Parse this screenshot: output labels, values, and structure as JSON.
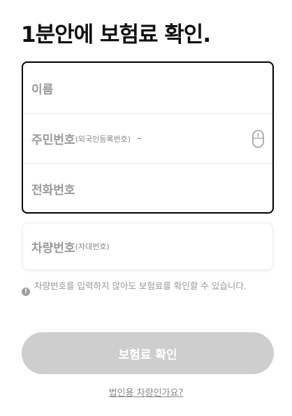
{
  "title": "1분안에 보험료 확인.",
  "form": {
    "name_placeholder": "이름",
    "ssn_placeholder": "주민번호",
    "ssn_hint": "(외국인등록번호)",
    "ssn_separator": "-",
    "phone_placeholder": "전화번호",
    "car_placeholder": "차량번호",
    "car_hint": "(자대번호)"
  },
  "notice": {
    "icon": "!",
    "text": "차량번호를 입력하지 않아도 보험료를 확인할 수 있습니다."
  },
  "confirm_label": "보험료 확인",
  "corporate_link": "법인용 차량인가요?",
  "colors": {
    "button_disabled": "#cecece",
    "border_active": "#000000",
    "placeholder": "#9a9a9a"
  }
}
